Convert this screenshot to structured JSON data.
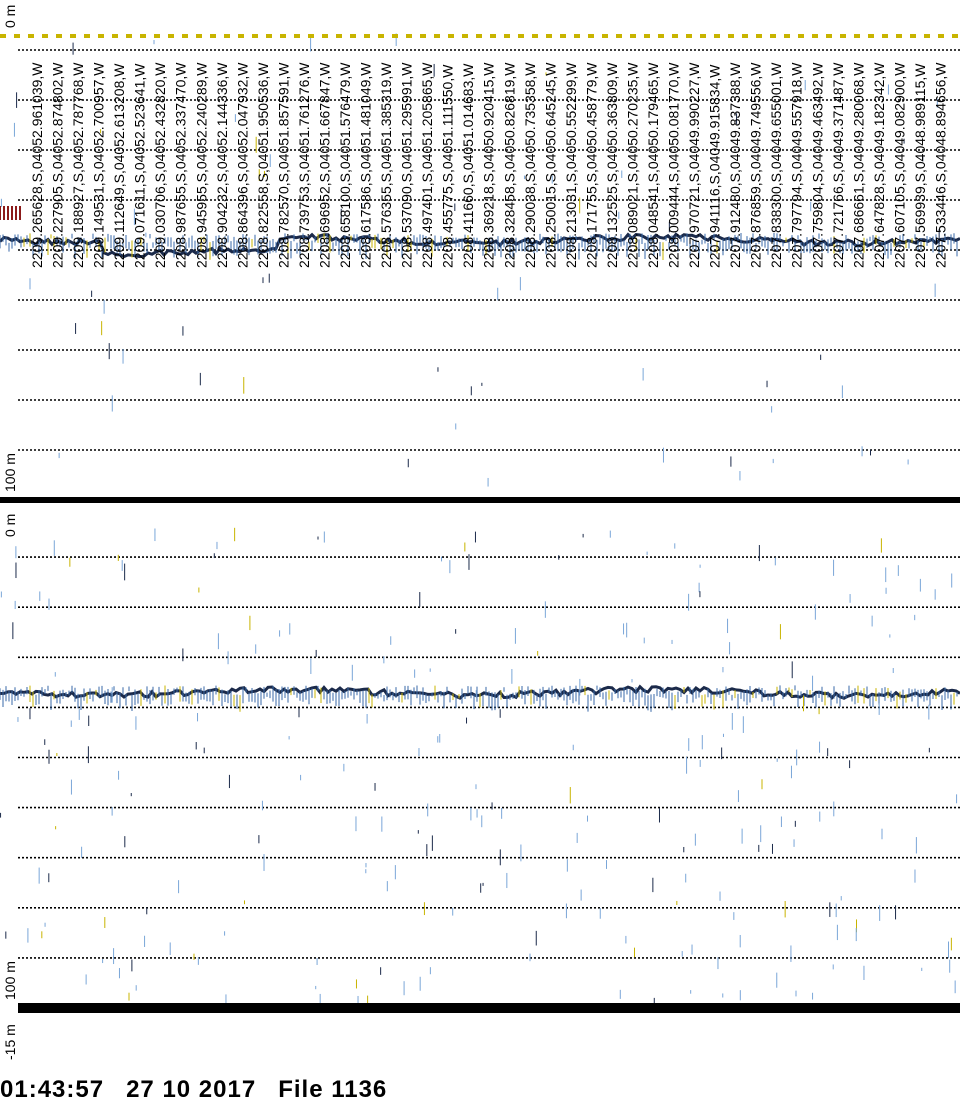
{
  "chart_data": {
    "type": "echogram",
    "title": "",
    "panels": [
      {
        "depth_range_m": [
          0,
          100
        ],
        "top_label": "0 m",
        "bottom_label": "100 m",
        "seabed_depth_m": 48
      },
      {
        "depth_range_m": [
          0,
          100
        ],
        "top_label": "0 m",
        "bottom_label": "100 m",
        "seabed_depth_m": 37
      }
    ],
    "footer_label": "-15 m",
    "position_labels": [
      "2209.265628,S,04052.961039,W",
      "2209.227905,S,04052.874802,W",
      "2209.188927,S,04052.787768,W",
      "2209.149531,S,04052.700957,W",
      "2209.112649,S,04052.613208,W",
      "2209.071611,S,04052.523641,W",
      "2209.030706,S,04052.432820,W",
      "2208.987655,S,04052.337470,W",
      "2208.945955,S,04052.240289,W",
      "2208.904232,S,04052.144336,W",
      "2208.864396,S,04052.047932,W",
      "2208.822558,S,04051.950536,W",
      "2208.782570,S,04051.857591,W",
      "2208.739753,S,04051.761276,W",
      "2208.696952,S,04051.667847,W",
      "2208.658100,S,04051.576479,W",
      "2208.617586,S,04051.481049,W",
      "2208.576355,S,04051.385319,W",
      "2208.537090,S,04051.295991,W",
      "2208.497401,S,04051.205865,W",
      "2208.455775,S,04051.111550,W",
      "2208.411660,S,04051.014683,W",
      "2208.369218,S,04050.920415,W",
      "2208.328458,S,04050.826819,W",
      "2208.290038,S,04050.735358,W",
      "2208.250015,S,04050.645245,W",
      "2208.213031,S,04050.552299,W",
      "2208.171755,S,04050.458779,W",
      "2208.132525,S,04050.363809,W",
      "2208.089021,S,04050.270235,W",
      "2208.048541,S,04050.179465,W",
      "2208.009444,S,04050.081770,W",
      "2207.970721,S,04049.990227,W",
      "2207.941116,S,04049.915834,W",
      "2207.912480,S,04049.837388,W",
      "2207.876859,S,04049.749556,W",
      "2207.838300,S,04049.655001,W",
      "2207.797794,S,04049.557918,W",
      "2207.759804,S,04049.463492,W",
      "2207.721766,S,04049.371487,W",
      "2207.686661,S,04049.280068,W",
      "2207.647828,S,04049.182342,W",
      "2207.607105,S,04049.082900,W",
      "2207.569939,S,04048.989115,W",
      "2207.533446,S,04048.894656,W"
    ],
    "colors": {
      "echo_dark": "#1b2a4a",
      "echo_mid": "#3a6aa8",
      "echo_light": "#7aa6d8",
      "echo_yellow": "#c8b400",
      "echo_red": "#8b1a1a"
    }
  },
  "footer": {
    "time": "01:43:57",
    "date": "27 10 2017",
    "file": "File 1136"
  }
}
